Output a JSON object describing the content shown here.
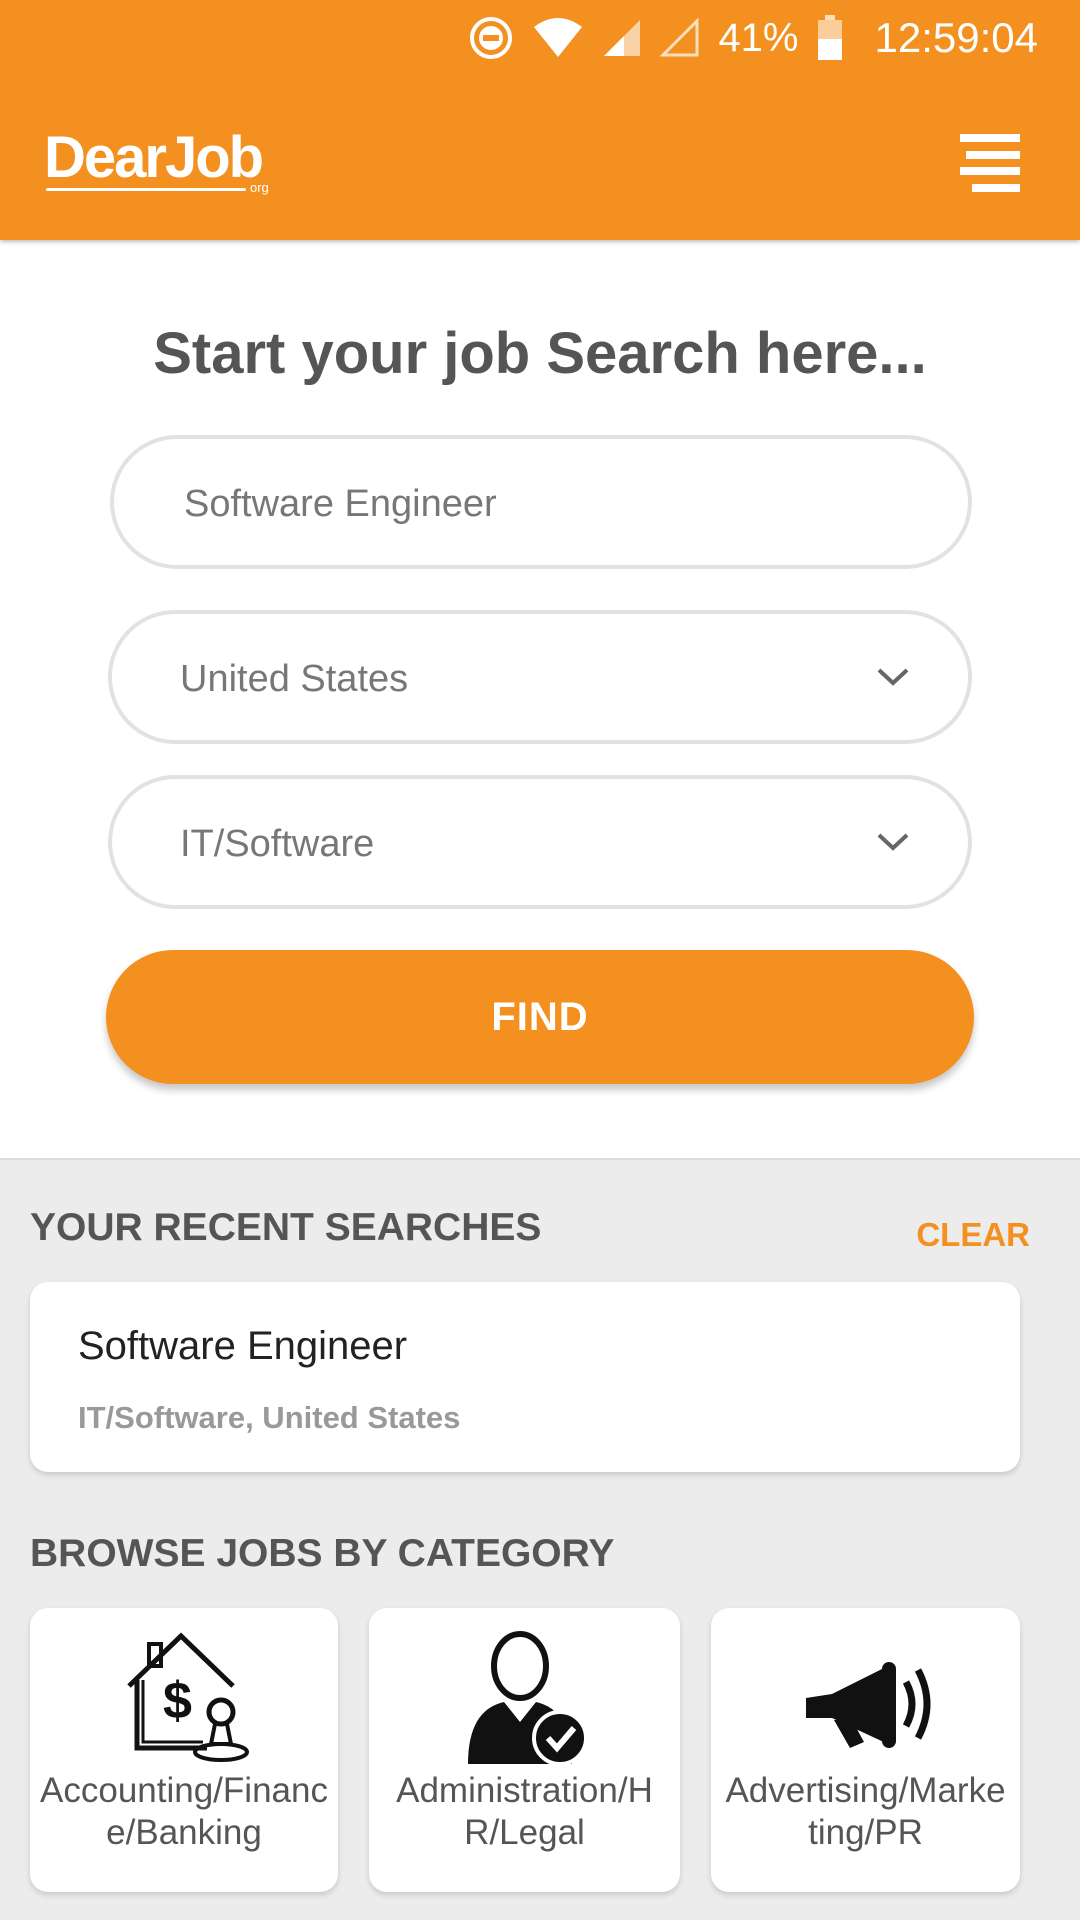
{
  "status_bar": {
    "battery": "41%",
    "time": "12:59:04"
  },
  "header": {
    "logo_text": "DearJob",
    "logo_sub": "org"
  },
  "search": {
    "headline": "Start your job Search here...",
    "keyword": "Software Engineer",
    "country": "United States",
    "category": "IT/Software",
    "find_label": "FIND"
  },
  "recent": {
    "section_title": "YOUR RECENT SEARCHES",
    "clear_label": "CLEAR",
    "items": [
      {
        "title": "Software Engineer",
        "subtitle": "IT/Software, United States"
      }
    ]
  },
  "categories": {
    "section_title": "BROWSE JOBS BY CATEGORY",
    "items": [
      {
        "label": "Accounting/Finance/Banking",
        "icon": "accounting-house-dollar-icon"
      },
      {
        "label": "Administration/HR/Legal",
        "icon": "person-check-icon"
      },
      {
        "label": "Advertising/Marketing/PR",
        "icon": "megaphone-icon"
      }
    ]
  },
  "colors": {
    "brand": "#f39020",
    "background": "#ececec",
    "text_heading": "#555555"
  }
}
